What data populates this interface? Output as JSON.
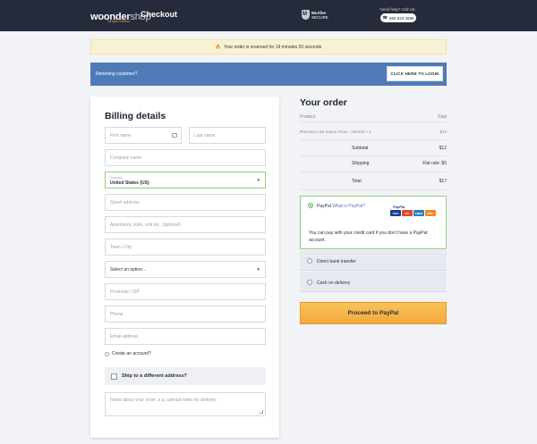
{
  "header": {
    "logo_main": "woonder",
    "logo_light": "shop",
    "logo_sub": "Simple Edition",
    "page_title": "Checkout",
    "security_line1": "McAfee",
    "security_line2": "SECURE",
    "help_text": "Need help? Call Us:",
    "phone": "555 523 4598"
  },
  "notice": {
    "icon": "fire-icon",
    "text": "Your order is reserved for 19 minutes 20 seconds"
  },
  "returning": {
    "text": "Returning customer?",
    "button": "CLICK HERE TO LOGIN"
  },
  "billing": {
    "title": "Billing details",
    "first_name_placeholder": "First name",
    "last_name_placeholder": "Last name",
    "company_placeholder": "Company name",
    "country_label": "Country",
    "country_value": "United States (US)",
    "street_placeholder": "Street address",
    "apartment_placeholder": "Apartment, suite, unit etc. (optional)",
    "city_placeholder": "Town / City",
    "state_select": "Select an option…",
    "postcode_placeholder": "Postcode / ZIP",
    "phone_placeholder": "Phone",
    "email_placeholder": "Email address",
    "create_account": "Create an account?",
    "ship_different": "Ship to a different address?",
    "notes_placeholder": "Notes about your order, e.g. special notes for delivery."
  },
  "order": {
    "title": "Your order",
    "col_product": "Product",
    "col_total": "Total",
    "item_name": "Premium Live Indoor Ficus - Normal × 1",
    "item_total": "$12",
    "subtotal_label": "Subtotal",
    "subtotal_value": "$12",
    "shipping_label": "Shipping",
    "shipping_value": "Flat rate: $5",
    "total_label": "Total",
    "total_value": "$17"
  },
  "payment": {
    "paypal_label": "PayPal",
    "paypal_link": "What is PayPal?",
    "paypal_logo": "PayPal",
    "cards": [
      "VISA",
      "MC",
      "AMEX",
      "DISC"
    ],
    "paypal_desc": "You can pay with your credit card if you don't have a PayPal account.",
    "bank_label": "Direct bank transfer",
    "cod_label": "Cash on delivery",
    "proceed_button": "Proceed to PayPal"
  }
}
